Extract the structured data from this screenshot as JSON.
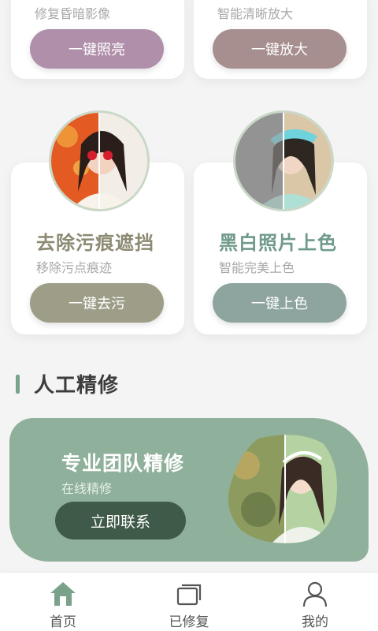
{
  "colors": {
    "accent_green": "#7aa28a",
    "banner_bg": "#8fb09a",
    "banner_button": "#3f5a48",
    "btn_brighten": "#b08fab",
    "btn_enlarge": "#a88f8f",
    "btn_stain": "#9e9e88",
    "btn_colorize": "#8ea59f",
    "title_stain": "#8c8a72",
    "title_colorize": "#6f9a89"
  },
  "cards": [
    {
      "subtitle": "修复昏暗影像",
      "button": "一键照亮"
    },
    {
      "subtitle": "智能清晰放大",
      "button": "一键放大"
    },
    {
      "title": "去除污痕遮挡",
      "subtitle": "移除污点痕迹",
      "button": "一键去污"
    },
    {
      "title": "黑白照片上色",
      "subtitle": "智能完美上色",
      "button": "一键上色"
    }
  ],
  "section": {
    "title": "人工精修"
  },
  "banner": {
    "title": "专业团队精修",
    "subtitle": "在线精修",
    "button": "立即联系"
  },
  "tabbar": [
    {
      "label": "首页",
      "icon": "home-icon",
      "active": true
    },
    {
      "label": "已修复",
      "icon": "stack-icon"
    },
    {
      "label": "我的",
      "icon": "person-icon"
    }
  ]
}
